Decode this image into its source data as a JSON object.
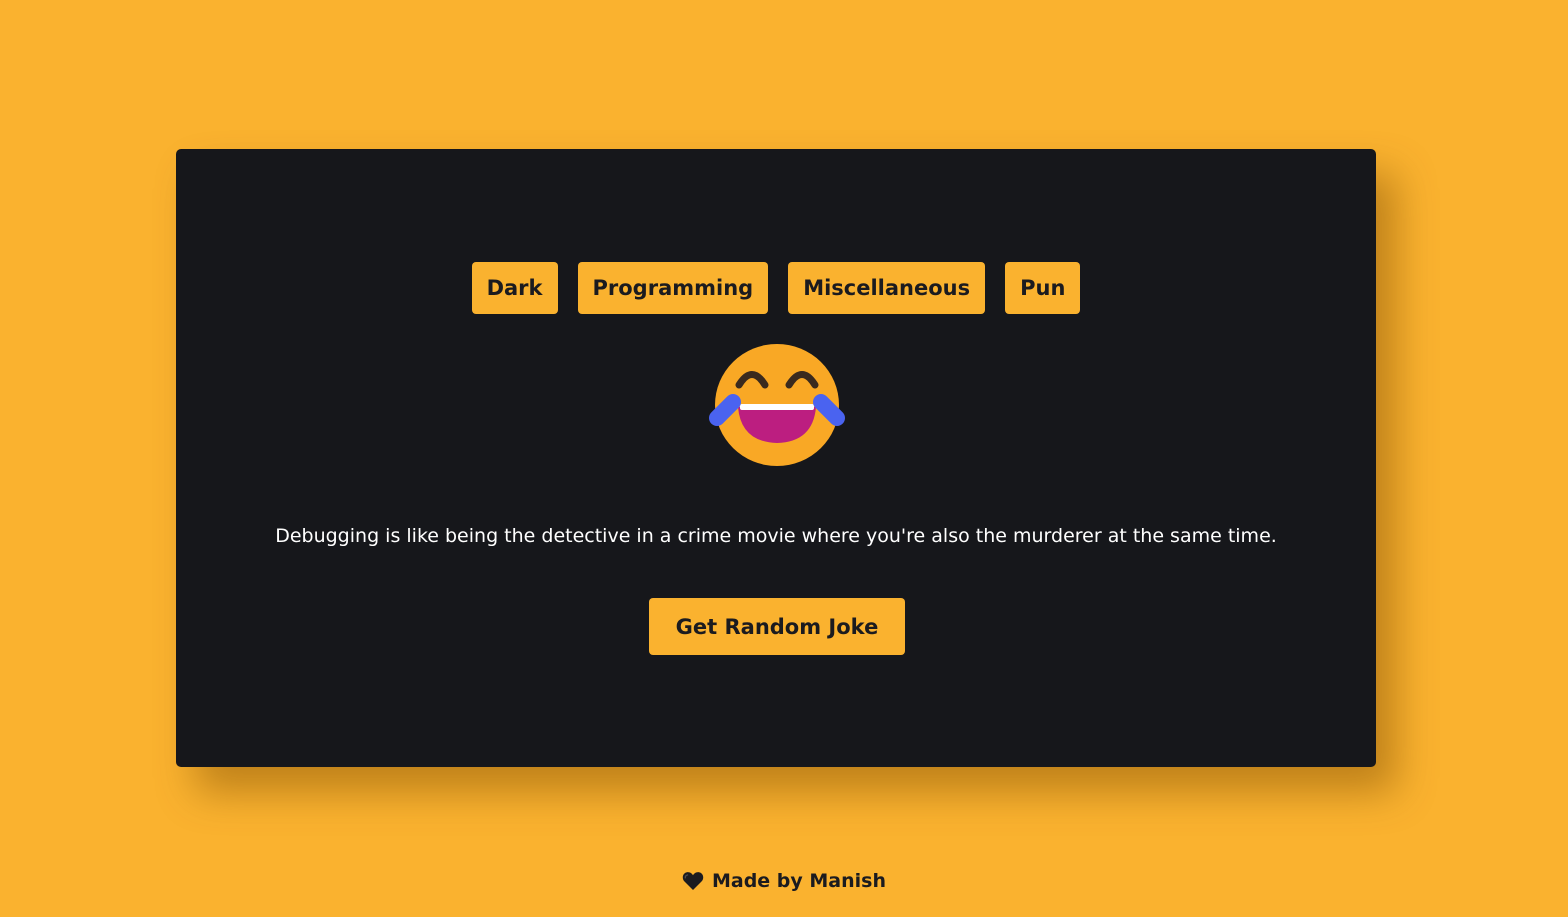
{
  "categories": {
    "dark": "Dark",
    "programming": "Programming",
    "miscellaneous": "Miscellaneous",
    "pun": "Pun"
  },
  "emoji": "laughing-with-tears-icon",
  "joke": "Debugging is like being the detective in a crime movie where you're also the murderer at the same time.",
  "cta_label": "Get Random Joke",
  "footer": {
    "icon": "heart-icon",
    "text": "Made by Manish"
  },
  "colors": {
    "background": "#fab22f",
    "card": "#16171b",
    "accent": "#fab22f",
    "text_light": "#ffffff",
    "text_dark": "#1b1b1f"
  }
}
